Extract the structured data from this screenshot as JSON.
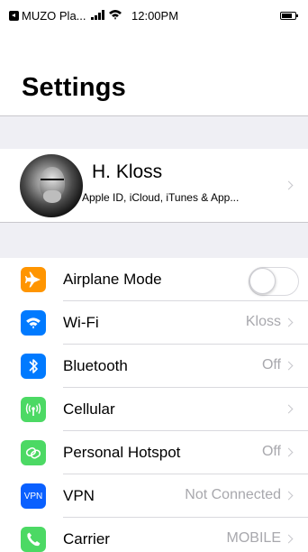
{
  "status_bar": {
    "back_label": "MUZO Pla...",
    "time": "12:00PM"
  },
  "header": {
    "title": "Settings"
  },
  "profile": {
    "name": "H. Kloss",
    "subtitle": "Apple ID, iCloud, iTunes & App..."
  },
  "settings": [
    {
      "label": "Airplane Mode",
      "value": "",
      "icon": "airplane-icon",
      "color": "#ff9500",
      "toggle": true,
      "toggle_on": false
    },
    {
      "label": "Wi-Fi",
      "value": "Kloss",
      "icon": "wifi-icon",
      "color": "#007aff"
    },
    {
      "label": "Bluetooth",
      "value": "Off",
      "icon": "bluetooth-icon",
      "color": "#007aff"
    },
    {
      "label": "Cellular",
      "value": "",
      "icon": "cellular-antenna-icon",
      "color": "#4cd964"
    },
    {
      "label": "Personal Hotspot",
      "value": "Off",
      "icon": "hotspot-link-icon",
      "color": "#4cd964"
    },
    {
      "label": "VPN",
      "value": "Not Connected",
      "icon": "vpn-icon",
      "icon_text": "VPN",
      "color": "#0a60ff"
    },
    {
      "label": "Carrier",
      "value": "MOBILE",
      "icon": "phone-icon",
      "color": "#4cd964"
    }
  ],
  "colors": {
    "group_background": "#efeff4",
    "secondary_text": "#a8a8ad",
    "chevron": "#c7c7cc"
  }
}
